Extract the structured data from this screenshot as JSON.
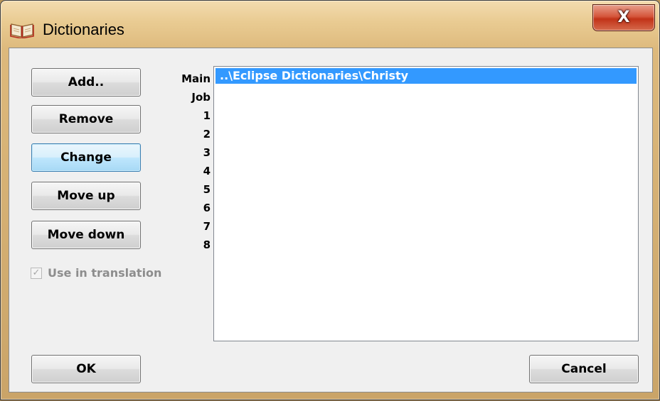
{
  "window": {
    "title": "Dictionaries",
    "close_glyph": "X"
  },
  "buttons": {
    "add": "Add..",
    "remove": "Remove",
    "change": "Change",
    "move_up": "Move up",
    "move_down": "Move down",
    "ok": "OK",
    "cancel": "Cancel"
  },
  "row_labels": [
    "Main",
    "Job",
    "1",
    "2",
    "3",
    "4",
    "5",
    "6",
    "7",
    "8"
  ],
  "dictionary_list": {
    "items": [
      "..\\Eclipse Dictionaries\\Christy"
    ],
    "selected_index": 0
  },
  "use_in_translation": {
    "label": "Use in translation",
    "checked": true,
    "enabled": false
  },
  "colors": {
    "selection": "#3399ff",
    "focused_button": "#bee6fd",
    "close_button": "#c23318"
  },
  "icons": {
    "title": "open-book-icon",
    "close": "close-icon",
    "check": "checkmark-icon"
  }
}
